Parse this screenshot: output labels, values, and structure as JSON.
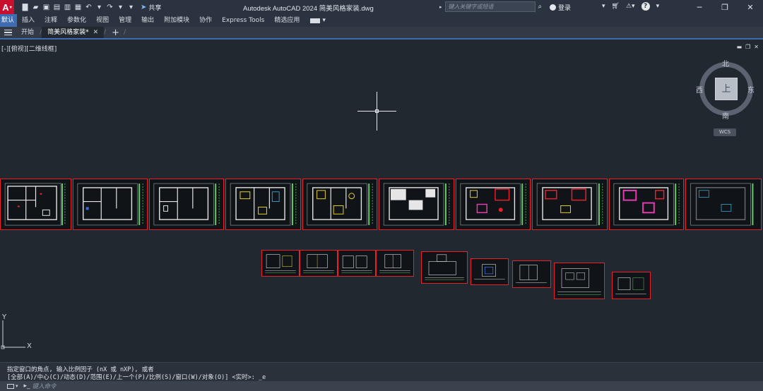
{
  "titlebar": {
    "app_letter": "A",
    "share_label": "共享",
    "title": "Autodesk AutoCAD 2024    简美风格家装.dwg",
    "search_placeholder": "键入关键字或短语",
    "login_label": "登录"
  },
  "ribbon": {
    "tabs": [
      "默认",
      "插入",
      "注释",
      "参数化",
      "视图",
      "管理",
      "输出",
      "附加模块",
      "协作",
      "Express Tools",
      "精选应用"
    ]
  },
  "filetabs": {
    "start_label": "开始",
    "active_label": "简美风格家装*"
  },
  "viewport": {
    "label": "[-][俯视][二维线框]",
    "viewcube": {
      "face": "上",
      "north": "北",
      "south": "南",
      "east": "东",
      "west": "西",
      "wcs": "WCS"
    },
    "ucs": {
      "x": "X",
      "y": "Y"
    }
  },
  "command": {
    "history_line1": "指定窗口的角点, 输入比例因子 (nX 或 nXP), 或者",
    "history_line2": "[全部(A)/中心(C)/动态(D)/范围(E)/上一个(P)/比例(S)/窗口(W)/对象(O)] <实时>: _e",
    "placeholder": "键入命令"
  },
  "colors": {
    "accent": "#3d6cb0",
    "frame": "#e8202a",
    "app": "#c8102e"
  }
}
